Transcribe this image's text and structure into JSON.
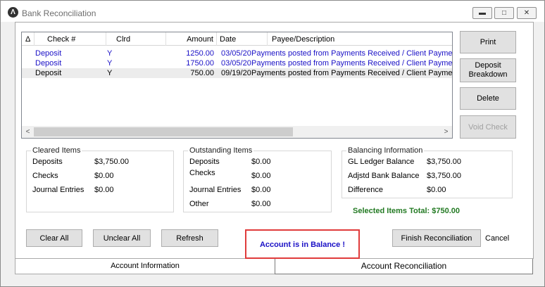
{
  "window": {
    "title": "Bank Reconciliation",
    "min_glyph": "▬",
    "max_glyph": "□",
    "close_glyph": "✕",
    "app_icon": "Λ"
  },
  "grid": {
    "sort_indicator": "Δ",
    "columns": [
      "Check #",
      "Clrd",
      "Amount",
      "Date",
      "Payee/Description"
    ],
    "rows": [
      {
        "check": "Deposit",
        "clrd": "Y",
        "amount": "1250.00",
        "date": "03/05/2019",
        "payee": "Payments posted from Payments Received / Client Paymen"
      },
      {
        "check": "Deposit",
        "clrd": "Y",
        "amount": "1750.00",
        "date": "03/05/2019",
        "payee": "Payments posted from Payments Received / Client Paymen"
      },
      {
        "check": "Deposit",
        "clrd": "Y",
        "amount": "750.00",
        "date": "09/19/2019",
        "payee": "Payments posted from Payments Received / Client Paymen"
      }
    ],
    "scroll_left": "<",
    "scroll_right": ">"
  },
  "side_buttons": {
    "print": "Print",
    "deposit_1": "Deposit",
    "deposit_2": "Breakdown",
    "delete": "Delete",
    "void": "Void Check"
  },
  "cleared": {
    "title": "Cleared Items",
    "deposits_label": "Deposits",
    "deposits_value": "$3,750.00",
    "checks_label": "Checks",
    "checks_value": "$0.00",
    "journal_label": "Journal Entries",
    "journal_value": "$0.00"
  },
  "outstanding": {
    "title": "Outstanding Items",
    "deposits_label": "Deposits",
    "deposits_value": "$0.00",
    "checks_label": "Checks",
    "checks_value": "$0.00",
    "journal_label": "Journal Entries",
    "journal_value": "$0.00",
    "other_label": "Other",
    "other_value": "$0.00"
  },
  "balancing": {
    "title": "Balancing Information",
    "gl_label": "GL Ledger Balance",
    "gl_value": "$3,750.00",
    "bank_label": "Adjstd Bank Balance",
    "bank_value": "$3,750.00",
    "diff_label": "Difference",
    "diff_value": "$0.00"
  },
  "selected_total": "Selected Items Total: $750.00",
  "bottom_buttons": {
    "clear_all": "Clear All",
    "unclear_all": "Unclear All",
    "refresh": "Refresh",
    "finish": "Finish Reconciliation",
    "cancel": "Cancel"
  },
  "balance_message": "Account is in Balance !",
  "tabs": {
    "info": "Account Information",
    "recon": "Account Reconciliation"
  },
  "colors": {
    "blue_text": "#1a10c6",
    "total_green": "#237a23",
    "balance_border": "#e03b3b"
  }
}
